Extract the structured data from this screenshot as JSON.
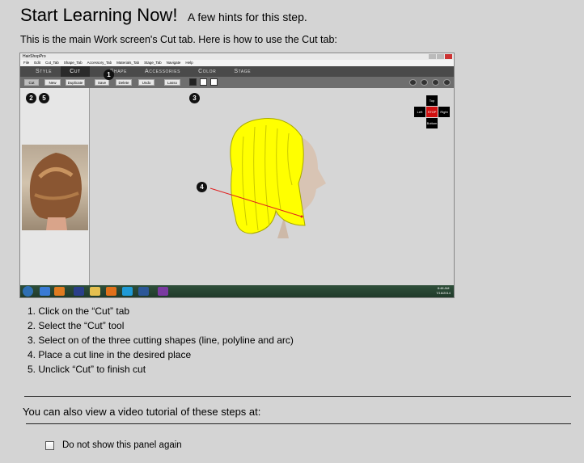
{
  "header": {
    "title": "Start Learning Now!",
    "subtitle": "A few hints for this step."
  },
  "intro": "This is the main Work screen's Cut tab. Here is how to use the Cut tab:",
  "screenshot": {
    "app_title": "HairShopPro",
    "menu": [
      "File",
      "Edit",
      "Cut_Tab",
      "Shape_Tab",
      "Accessory_Tab",
      "Materials_Tab",
      "Stage_Tab",
      "Navigate",
      "Help"
    ],
    "tabs": [
      "Style",
      "Cut",
      "Shape",
      "Accessories",
      "Color",
      "Stage"
    ],
    "active_tab": "Cut",
    "toolbar": {
      "cut": "Cut",
      "new": "New",
      "duplicate": "Duplicate",
      "save": "Save",
      "delete": "Delete",
      "undo": "Undo",
      "lasso": "Lasso"
    },
    "markers": [
      "1",
      "2",
      "5",
      "3",
      "4"
    ],
    "nav": {
      "top": "Top",
      "left": "Left",
      "stop": "STOP",
      "right": "Right",
      "bottom": "Bottom"
    },
    "clock_time": "8:48 AM",
    "clock_date": "7/16/2014",
    "hair_color": "#ffff00",
    "cut_line_color": "#e02020",
    "stop_color": "#d01010"
  },
  "steps": [
    "1. Click on the “Cut” tab",
    "2. Select the “Cut” tool",
    "3. Select on of the three cutting shapes (line, polyline and arc)",
    "4. Place a cut line in the desired place",
    "5. Unclick “Cut” to finish cut"
  ],
  "video_text": "You can also view a video tutorial of these steps at:",
  "checkbox_label": "Do not show this panel again",
  "checkbox_checked": false
}
